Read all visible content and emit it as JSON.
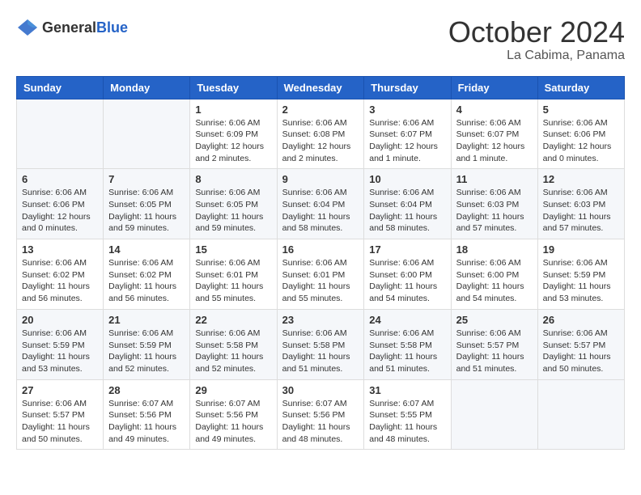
{
  "header": {
    "logo": {
      "general": "General",
      "blue": "Blue"
    },
    "title": "October 2024",
    "location": "La Cabima, Panama"
  },
  "weekdays": [
    "Sunday",
    "Monday",
    "Tuesday",
    "Wednesday",
    "Thursday",
    "Friday",
    "Saturday"
  ],
  "weeks": [
    [
      {
        "day": "",
        "info": ""
      },
      {
        "day": "",
        "info": ""
      },
      {
        "day": "1",
        "info": "Sunrise: 6:06 AM\nSunset: 6:09 PM\nDaylight: 12 hours and 2 minutes."
      },
      {
        "day": "2",
        "info": "Sunrise: 6:06 AM\nSunset: 6:08 PM\nDaylight: 12 hours and 2 minutes."
      },
      {
        "day": "3",
        "info": "Sunrise: 6:06 AM\nSunset: 6:07 PM\nDaylight: 12 hours and 1 minute."
      },
      {
        "day": "4",
        "info": "Sunrise: 6:06 AM\nSunset: 6:07 PM\nDaylight: 12 hours and 1 minute."
      },
      {
        "day": "5",
        "info": "Sunrise: 6:06 AM\nSunset: 6:06 PM\nDaylight: 12 hours and 0 minutes."
      }
    ],
    [
      {
        "day": "6",
        "info": "Sunrise: 6:06 AM\nSunset: 6:06 PM\nDaylight: 12 hours and 0 minutes."
      },
      {
        "day": "7",
        "info": "Sunrise: 6:06 AM\nSunset: 6:05 PM\nDaylight: 11 hours and 59 minutes."
      },
      {
        "day": "8",
        "info": "Sunrise: 6:06 AM\nSunset: 6:05 PM\nDaylight: 11 hours and 59 minutes."
      },
      {
        "day": "9",
        "info": "Sunrise: 6:06 AM\nSunset: 6:04 PM\nDaylight: 11 hours and 58 minutes."
      },
      {
        "day": "10",
        "info": "Sunrise: 6:06 AM\nSunset: 6:04 PM\nDaylight: 11 hours and 58 minutes."
      },
      {
        "day": "11",
        "info": "Sunrise: 6:06 AM\nSunset: 6:03 PM\nDaylight: 11 hours and 57 minutes."
      },
      {
        "day": "12",
        "info": "Sunrise: 6:06 AM\nSunset: 6:03 PM\nDaylight: 11 hours and 57 minutes."
      }
    ],
    [
      {
        "day": "13",
        "info": "Sunrise: 6:06 AM\nSunset: 6:02 PM\nDaylight: 11 hours and 56 minutes."
      },
      {
        "day": "14",
        "info": "Sunrise: 6:06 AM\nSunset: 6:02 PM\nDaylight: 11 hours and 56 minutes."
      },
      {
        "day": "15",
        "info": "Sunrise: 6:06 AM\nSunset: 6:01 PM\nDaylight: 11 hours and 55 minutes."
      },
      {
        "day": "16",
        "info": "Sunrise: 6:06 AM\nSunset: 6:01 PM\nDaylight: 11 hours and 55 minutes."
      },
      {
        "day": "17",
        "info": "Sunrise: 6:06 AM\nSunset: 6:00 PM\nDaylight: 11 hours and 54 minutes."
      },
      {
        "day": "18",
        "info": "Sunrise: 6:06 AM\nSunset: 6:00 PM\nDaylight: 11 hours and 54 minutes."
      },
      {
        "day": "19",
        "info": "Sunrise: 6:06 AM\nSunset: 5:59 PM\nDaylight: 11 hours and 53 minutes."
      }
    ],
    [
      {
        "day": "20",
        "info": "Sunrise: 6:06 AM\nSunset: 5:59 PM\nDaylight: 11 hours and 53 minutes."
      },
      {
        "day": "21",
        "info": "Sunrise: 6:06 AM\nSunset: 5:59 PM\nDaylight: 11 hours and 52 minutes."
      },
      {
        "day": "22",
        "info": "Sunrise: 6:06 AM\nSunset: 5:58 PM\nDaylight: 11 hours and 52 minutes."
      },
      {
        "day": "23",
        "info": "Sunrise: 6:06 AM\nSunset: 5:58 PM\nDaylight: 11 hours and 51 minutes."
      },
      {
        "day": "24",
        "info": "Sunrise: 6:06 AM\nSunset: 5:58 PM\nDaylight: 11 hours and 51 minutes."
      },
      {
        "day": "25",
        "info": "Sunrise: 6:06 AM\nSunset: 5:57 PM\nDaylight: 11 hours and 51 minutes."
      },
      {
        "day": "26",
        "info": "Sunrise: 6:06 AM\nSunset: 5:57 PM\nDaylight: 11 hours and 50 minutes."
      }
    ],
    [
      {
        "day": "27",
        "info": "Sunrise: 6:06 AM\nSunset: 5:57 PM\nDaylight: 11 hours and 50 minutes."
      },
      {
        "day": "28",
        "info": "Sunrise: 6:07 AM\nSunset: 5:56 PM\nDaylight: 11 hours and 49 minutes."
      },
      {
        "day": "29",
        "info": "Sunrise: 6:07 AM\nSunset: 5:56 PM\nDaylight: 11 hours and 49 minutes."
      },
      {
        "day": "30",
        "info": "Sunrise: 6:07 AM\nSunset: 5:56 PM\nDaylight: 11 hours and 48 minutes."
      },
      {
        "day": "31",
        "info": "Sunrise: 6:07 AM\nSunset: 5:55 PM\nDaylight: 11 hours and 48 minutes."
      },
      {
        "day": "",
        "info": ""
      },
      {
        "day": "",
        "info": ""
      }
    ]
  ]
}
